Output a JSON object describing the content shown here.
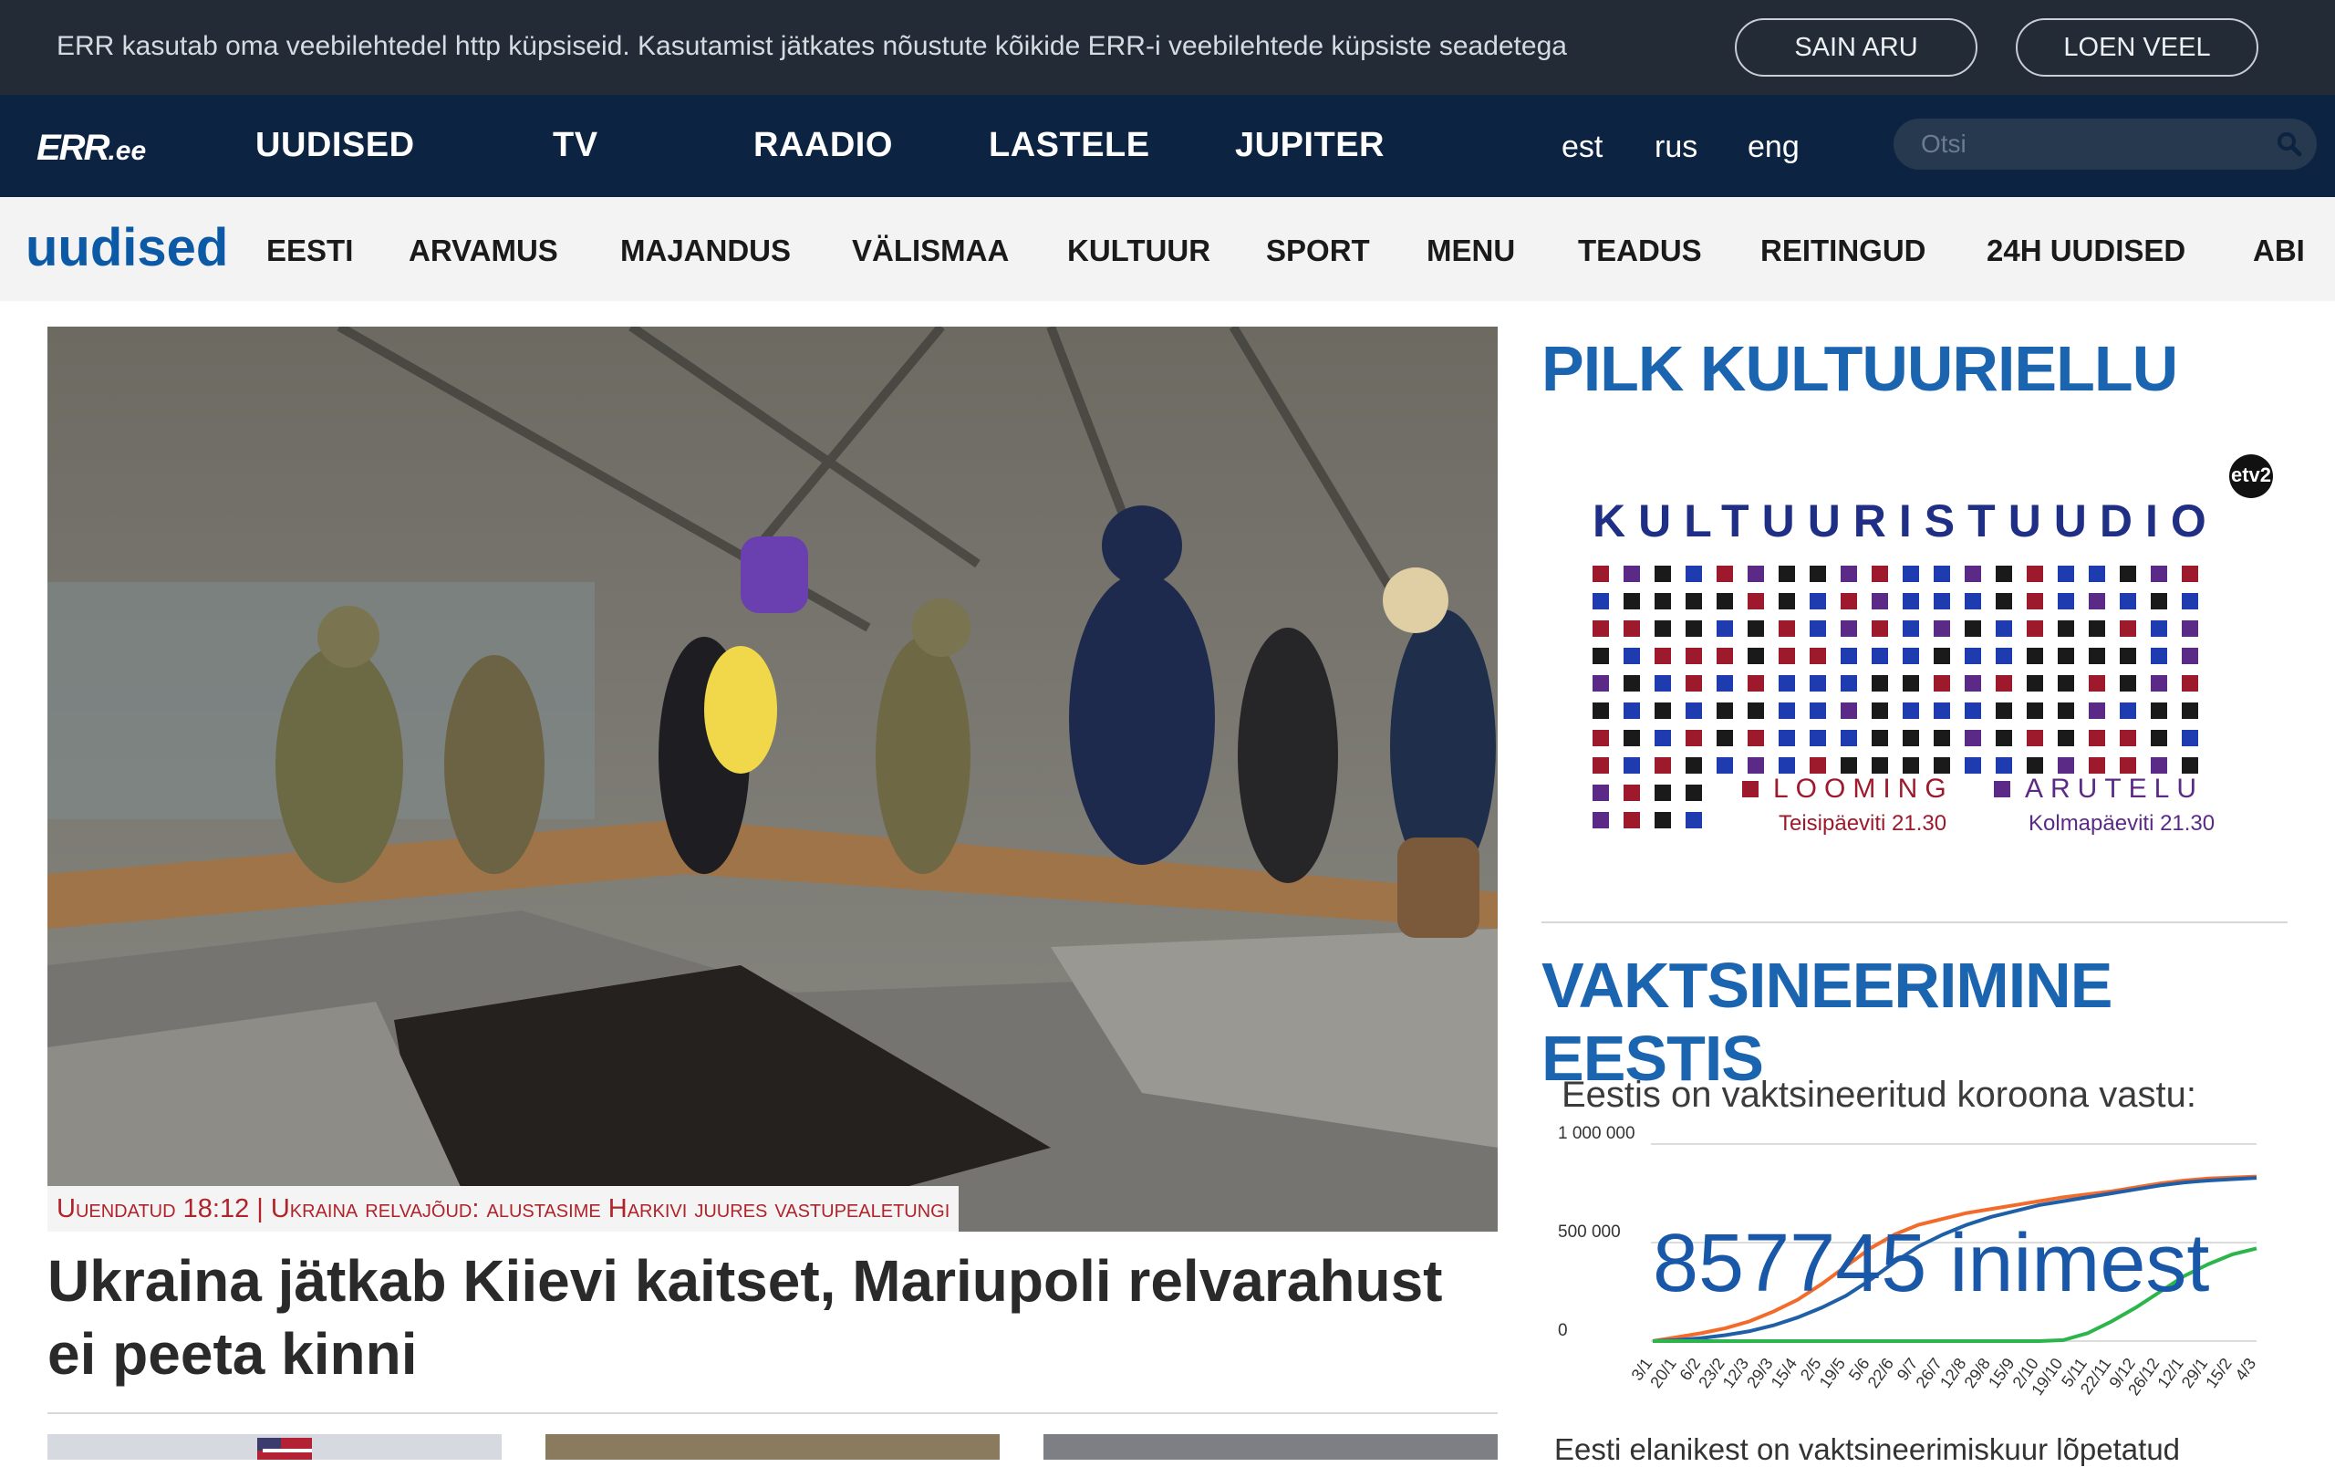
{
  "cookie": {
    "text": "ERR kasutab oma veebilehtedel http küpsiseid. Kasutamist jätkates nõustute kõikide ERR-i veebilehtede küpsiste seadetega",
    "accept_label": "SAIN ARU",
    "more_label": "LOEN VEEL"
  },
  "mainnav": {
    "logo": "ERR",
    "logo_suffix": ".ee",
    "items": [
      "UUDISED",
      "TV",
      "RAADIO",
      "LASTELE",
      "JUPITER"
    ],
    "languages": [
      "est",
      "rus",
      "eng"
    ],
    "search_placeholder": "Otsi"
  },
  "secnav": {
    "logo": "uudised",
    "items": [
      "EESTI",
      "ARVAMUS",
      "MAJANDUS",
      "VÄLISMAA",
      "KULTUUR",
      "SPORT",
      "MENU",
      "TEADUS",
      "REITINGUD",
      "24H UUDISED",
      "ABI"
    ]
  },
  "hero": {
    "tag": "Uuendatud 18:12 | Ukraina relvajõud: alustasime Harkivi juures vastupealetungi",
    "headline": "Ukraina jätkab Kiievi kaitset, Mariupoli relvarahust ei peeta kinni"
  },
  "sidebar": {
    "culture_title": "PILK KULTUURIELLU",
    "promo": {
      "title": "KULTUURISTUUDIO",
      "channel": "etv2",
      "left_label": "LOOMING",
      "left_time": "Teisipäeviti 21.30",
      "right_label": "ARUTELU",
      "right_time": "Kolmapäeviti 21.30"
    },
    "vaccination_title": "VAKTSINEERIMINE EESTIS",
    "vaccination_subtitle": "Eestis on vaktsineeritud koroona vastu:",
    "vaccinated_count": "857745 inimest",
    "footer_text": "Eesti elanikest on vaktsineerimiskuur lõpetatud"
  },
  "chart_data": {
    "type": "line",
    "title": "Eestis on vaktsineeritud koroona vastu:",
    "x": [
      "3/1",
      "20/1",
      "6/2",
      "23/2",
      "12/3",
      "29/3",
      "15/4",
      "2/5",
      "19/5",
      "5/6",
      "22/6",
      "9/7",
      "26/7",
      "12/8",
      "29/8",
      "15/9",
      "2/10",
      "19/10",
      "5/11",
      "22/11",
      "9/12",
      "26/12",
      "12/1",
      "29/1",
      "15/2",
      "4/3"
    ],
    "yticks": [
      "0",
      "500 000",
      "1 000 000"
    ],
    "ylim": [
      0,
      1000000
    ],
    "grid": true,
    "series": [
      {
        "color": "#f36b2b",
        "values": [
          0,
          20000,
          40000,
          65000,
          100000,
          150000,
          210000,
          290000,
          380000,
          470000,
          540000,
          590000,
          620000,
          650000,
          670000,
          690000,
          710000,
          730000,
          745000,
          760000,
          780000,
          800000,
          815000,
          825000,
          830000,
          835000
        ]
      },
      {
        "color": "#1f5fa8",
        "values": [
          0,
          5000,
          15000,
          30000,
          50000,
          80000,
          120000,
          170000,
          230000,
          310000,
          400000,
          480000,
          540000,
          590000,
          630000,
          660000,
          690000,
          710000,
          730000,
          750000,
          770000,
          790000,
          805000,
          815000,
          822000,
          828000
        ]
      },
      {
        "color": "#2bb54b",
        "values": [
          0,
          0,
          0,
          0,
          0,
          0,
          0,
          0,
          0,
          0,
          0,
          0,
          0,
          0,
          0,
          0,
          0,
          5000,
          40000,
          100000,
          170000,
          250000,
          330000,
          390000,
          440000,
          470000
        ]
      }
    ]
  }
}
